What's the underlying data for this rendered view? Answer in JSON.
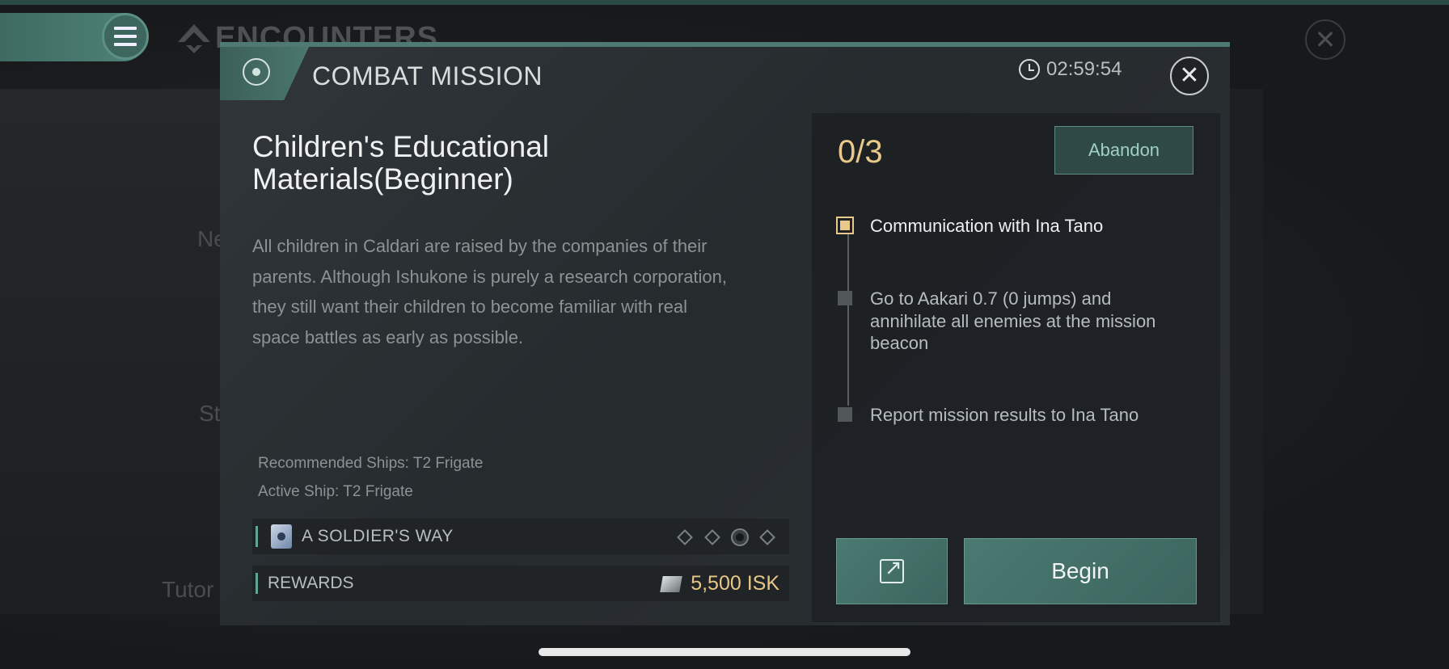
{
  "background": {
    "section_title": "ENCOUNTERS",
    "partial_labels": {
      "ne": "Ne",
      "st": "St",
      "tutor": "Tutor"
    }
  },
  "modal": {
    "mission_type": "COMBAT MISSION",
    "timer": "02:59:54",
    "title": "Children's Educational Materials(Beginner)",
    "description": "All children in Caldari are raised by the companies of their parents. Although Ishukone is purely a research corporation, they still want their children to become familiar with real space battles as early as possible.",
    "recommended_ships": "Recommended Ships: T2 Frigate",
    "active_ship": "Active Ship: T2 Frigate",
    "storyline": {
      "label": "A SOLDIER'S WAY"
    },
    "rewards": {
      "label": "REWARDS",
      "value": "5,500 ISK"
    },
    "progress": "0/3",
    "abandon_label": "Abandon",
    "objectives": [
      {
        "text": "Communication with Ina Tano",
        "active": true
      },
      {
        "text": "Go to Aakari 0.7 (0 jumps) and annihilate all enemies at the mission beacon",
        "active": false
      },
      {
        "text": "Report mission results to Ina Tano",
        "active": false
      }
    ],
    "begin_label": "Begin"
  },
  "colors": {
    "accent": "#4f7a73",
    "highlight": "#e8c98b",
    "reward": "#e7c785"
  }
}
